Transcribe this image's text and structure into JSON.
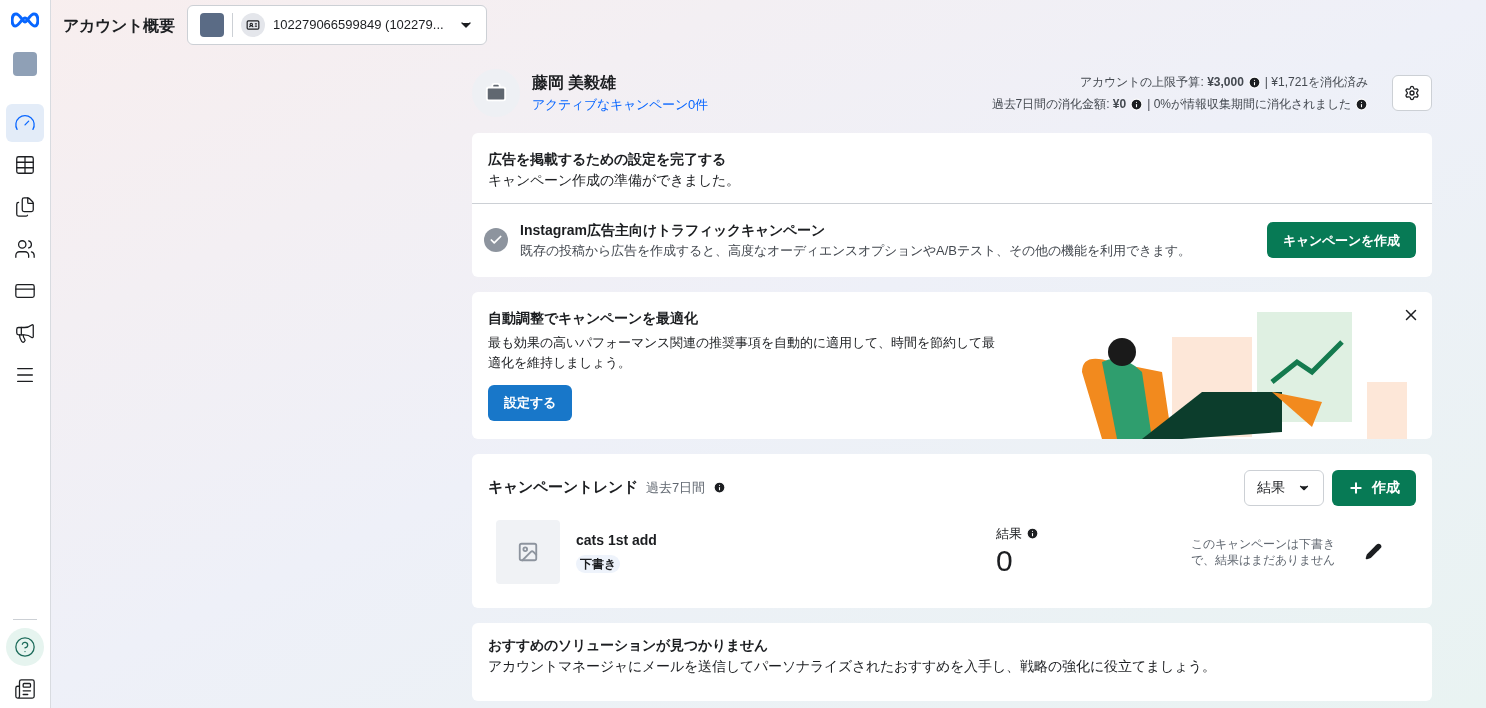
{
  "header": {
    "title": "アカウント概要",
    "account_selector": "102279066599849 (102279..."
  },
  "sidebar": {
    "items": [
      {
        "kind": "dashboard",
        "selected": true
      },
      {
        "kind": "table",
        "selected": false
      },
      {
        "kind": "pages",
        "selected": false
      },
      {
        "kind": "audience",
        "selected": false
      },
      {
        "kind": "billing",
        "selected": false
      },
      {
        "kind": "ads",
        "selected": false
      },
      {
        "kind": "menu",
        "selected": false
      }
    ],
    "bottom": [
      {
        "kind": "help",
        "selected": false
      },
      {
        "kind": "news",
        "selected": false
      }
    ]
  },
  "account": {
    "name": "藤岡 美毅雄",
    "campaigns_link": "アクティブなキャンペーン0件",
    "budget_label": "アカウントの上限予算: **¥3,000**",
    "budget_spent": "| ¥1,721を消化済み",
    "spend_label": "過去7日間の消化金額: **¥0**",
    "spend_note": "| 0%が情報収集期間に消化されました"
  },
  "setup_card": {
    "title": "広告を掲載するための設定を完了する",
    "subtitle": "キャンペーン作成の準備ができました。",
    "step_title": "Instagram広告主向けトラフィックキャンペーン",
    "step_text": "既存の投稿から広告を作成すると、高度なオーディエンスオプションやA/Bテスト、その他の機能を利用できます。",
    "step_done": true,
    "button": "キャンペーンを作成"
  },
  "optimize_card": {
    "title": "自動調整でキャンペーンを最適化",
    "text": "最も効果の高いパフォーマンス関連の推奨事項を自動的に適用して、時間を節約して最適化を維持しましょう。",
    "button": "設定する"
  },
  "trend_card": {
    "title": "キャンペーントレンド",
    "period": "過去7日間",
    "metric_dropdown": "結果",
    "create_button": "作成",
    "campaigns": [
      {
        "name": "cats 1st add",
        "status": "下書き",
        "metric_label": "結果",
        "metric_value": "0",
        "note": "このキャンペーンは下書きで、結果はまだありません"
      }
    ]
  },
  "solutions_card": {
    "title": "おすすめのソリューションが見つかりません",
    "text": "アカウントマネージャにメールを送信してパーソナライズされたおすすめを入手し、戦略の強化に役立てましょう。"
  }
}
